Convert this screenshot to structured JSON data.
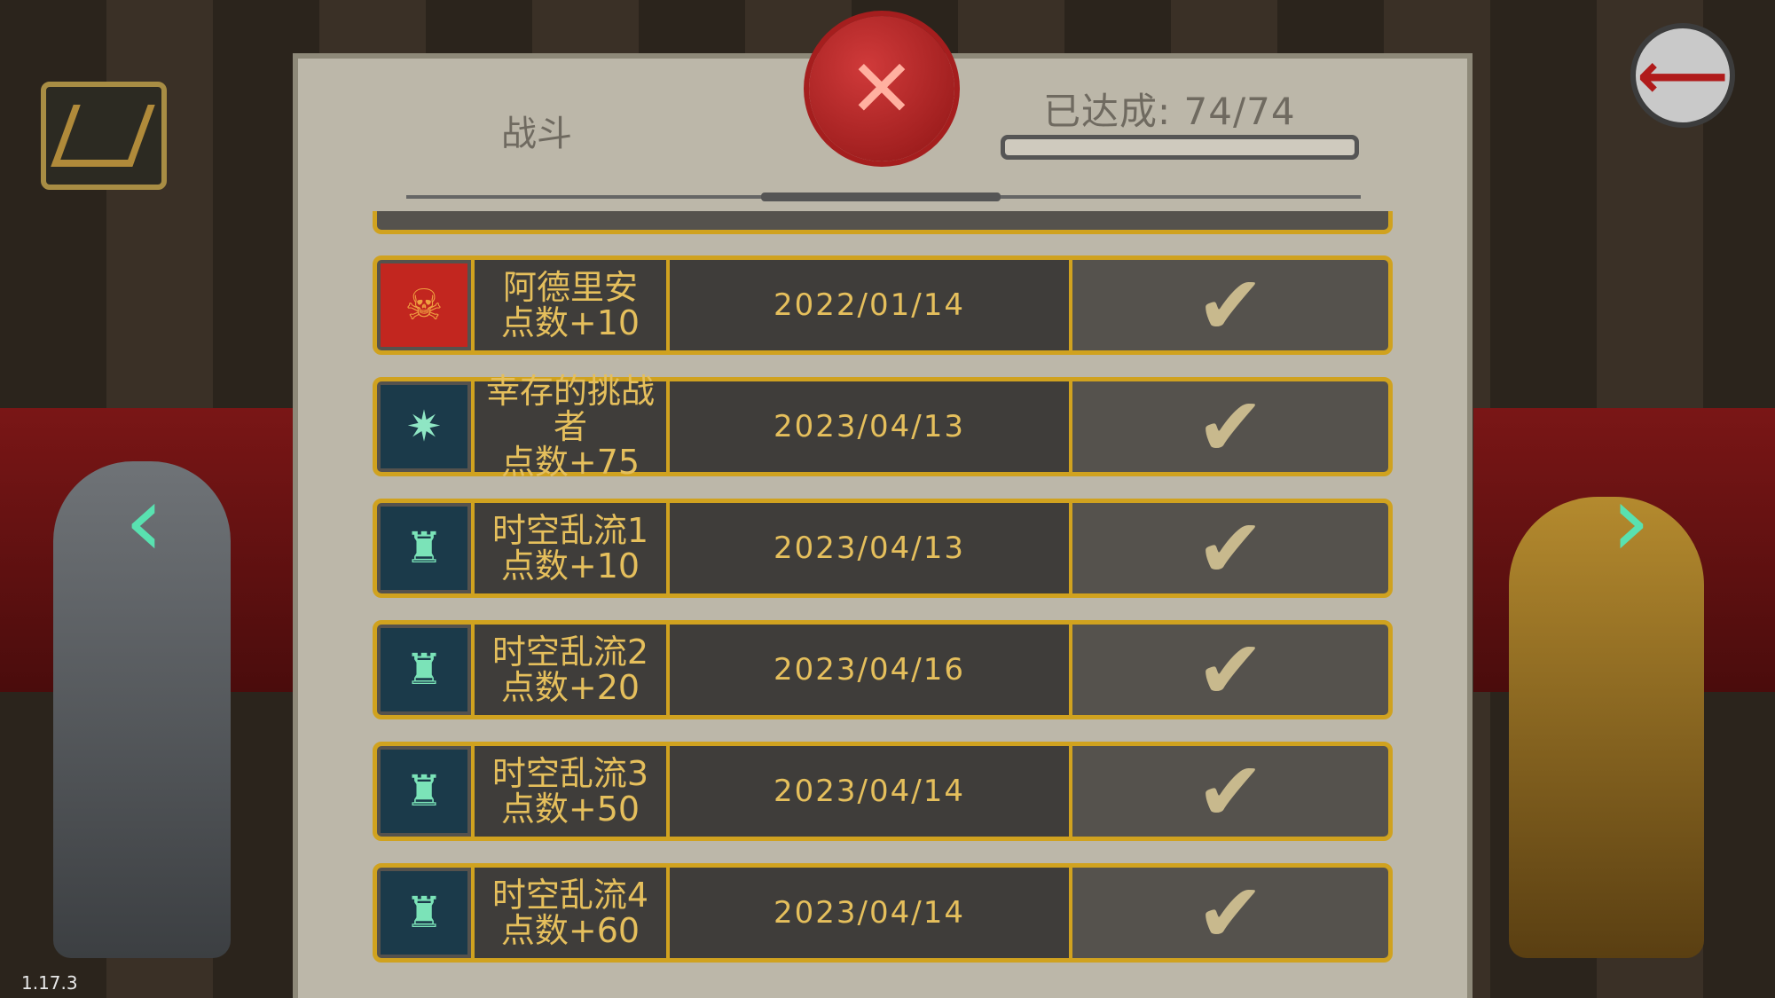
{
  "window": {
    "version": "1.17.3"
  },
  "panel": {
    "tab_label": "战斗",
    "achieved_label": "已达成: 74/74",
    "progress": 1.0
  },
  "rows": [
    {
      "icon": "monster-icon",
      "name": "阿德里安",
      "points": "点数+10",
      "date": "2022/01/14"
    },
    {
      "icon": "burst-icon",
      "name": "幸存的挑战者",
      "points": "点数+75",
      "date": "2023/04/13"
    },
    {
      "icon": "tower-1-icon",
      "name": "时空乱流1",
      "points": "点数+10",
      "date": "2023/04/13"
    },
    {
      "icon": "tower-2-icon",
      "name": "时空乱流2",
      "points": "点数+20",
      "date": "2023/04/16"
    },
    {
      "icon": "tower-3-icon",
      "name": "时空乱流3",
      "points": "点数+50",
      "date": "2023/04/14"
    },
    {
      "icon": "tower-4-icon",
      "name": "时空乱流4",
      "points": "点数+60",
      "date": "2023/04/14"
    }
  ]
}
